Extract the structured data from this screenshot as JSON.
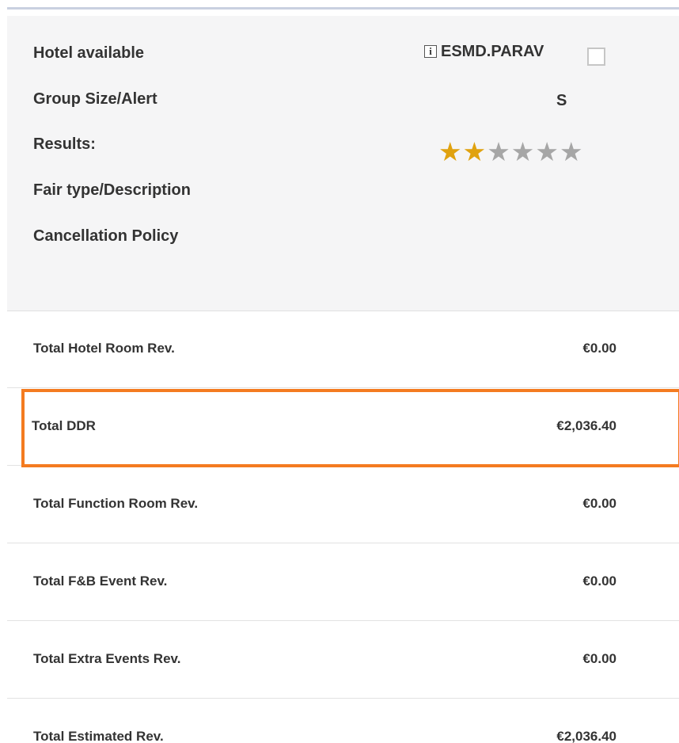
{
  "header": {
    "hotel_available_label": "Hotel available",
    "hotel_code": "ESMD.PARAV",
    "info_icon_glyph": "i",
    "group_size_label": "Group Size/Alert",
    "group_size_value": "S",
    "results_label": "Results:",
    "rating": {
      "filled": 2,
      "total": 6
    },
    "star_colors": {
      "filled": "#e0a20f",
      "empty": "#a6a6a6"
    },
    "fair_type_label": "Fair type/Description",
    "cancellation_label": "Cancellation Policy"
  },
  "revenue_rows": [
    {
      "label": "Total Hotel Room Rev.",
      "value": "€0.00"
    },
    {
      "label": "Total DDR",
      "value": "€2,036.40",
      "highlighted": true
    },
    {
      "label": "Total Function Room Rev.",
      "value": "€0.00"
    },
    {
      "label": "Total F&B Event Rev.",
      "value": "€0.00"
    },
    {
      "label": "Total Extra Events Rev.",
      "value": "€0.00"
    },
    {
      "label": "Total Estimated Rev.",
      "value": "€2,036.40"
    }
  ],
  "colors": {
    "highlight": "#f47b20",
    "header_bg": "#f5f5f6",
    "text": "#333333"
  }
}
